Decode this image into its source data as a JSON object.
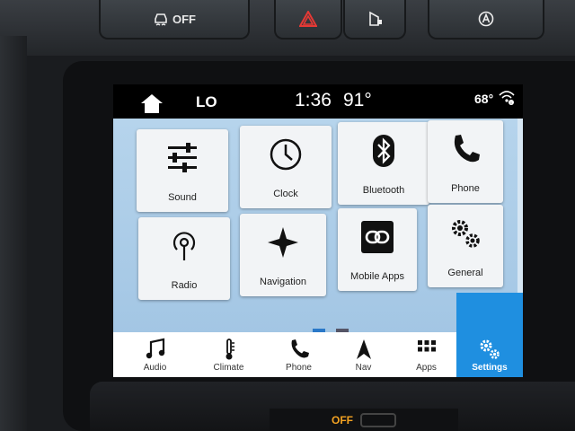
{
  "hardware": {
    "traction_label": "OFF"
  },
  "status": {
    "fan_level": "LO",
    "time": "1:36",
    "outside_temp": "91°",
    "inside_temp": "68°"
  },
  "apps": [
    {
      "label": "Sound",
      "icon": "sliders-icon"
    },
    {
      "label": "Clock",
      "icon": "clock-icon"
    },
    {
      "label": "Bluetooth",
      "icon": "bluetooth-icon"
    },
    {
      "label": "Phone",
      "icon": "phone-icon"
    },
    {
      "label": "Radio",
      "icon": "radio-icon"
    },
    {
      "label": "Navigation",
      "icon": "compass-star-icon"
    },
    {
      "label": "Mobile Apps",
      "icon": "link-icon"
    },
    {
      "label": "General",
      "icon": "gears-icon"
    }
  ],
  "page_indicator": {
    "current": 1,
    "total": 2
  },
  "navbar": [
    {
      "label": "Audio",
      "icon": "music-note-icon"
    },
    {
      "label": "Climate",
      "icon": "thermometer-icon"
    },
    {
      "label": "Phone",
      "icon": "phone-icon"
    },
    {
      "label": "Nav",
      "icon": "navigation-arrow-icon"
    },
    {
      "label": "Apps",
      "icon": "grid-icon"
    },
    {
      "label": "Settings",
      "icon": "gears-icon",
      "active": true
    }
  ],
  "colors": {
    "accent": "#1f8fe0",
    "grid_background": "#a3c6e4",
    "tile_background": "#f2f4f6",
    "bottom_indicator": "#f4a322"
  },
  "bottom_strip": {
    "label": "OFF"
  }
}
